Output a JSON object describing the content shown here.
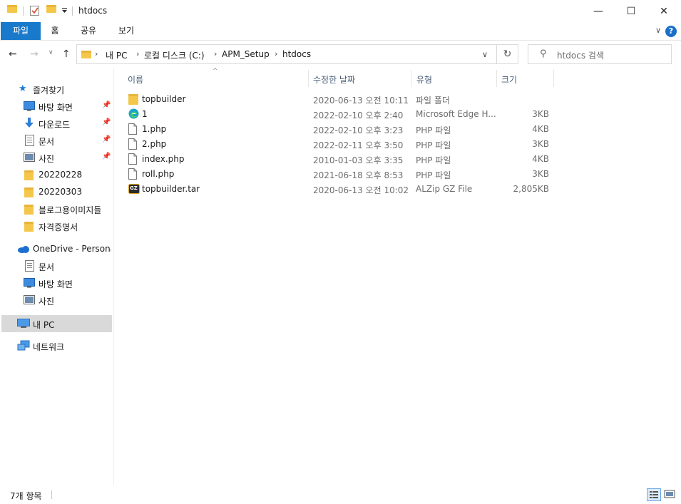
{
  "window": {
    "title": "htdocs",
    "minimize": "—",
    "maximize": "☐",
    "close": "✕"
  },
  "ribbon": {
    "tabs": [
      "파일",
      "홈",
      "공유",
      "보기"
    ],
    "expand": "∨",
    "help": "?"
  },
  "address": {
    "crumbs": [
      "내 PC",
      "로컬 디스크 (C:)",
      "APM_Setup",
      "htdocs"
    ],
    "dropdown": "∨",
    "refresh": "↻"
  },
  "search": {
    "placeholder": "htdocs 검색"
  },
  "sidebar": {
    "quick_access": "즐겨찾기",
    "quick_items": [
      {
        "label": "바탕 화면",
        "icon": "desktop-icon",
        "pinned": true
      },
      {
        "label": "다운로드",
        "icon": "download-icon",
        "pinned": true
      },
      {
        "label": "문서",
        "icon": "document-icon",
        "pinned": true
      },
      {
        "label": "사진",
        "icon": "pictures-icon",
        "pinned": true
      },
      {
        "label": "20220228",
        "icon": "folder-icon",
        "pinned": false
      },
      {
        "label": "20220303",
        "icon": "folder-icon",
        "pinned": false
      },
      {
        "label": "블로그용이미지들",
        "icon": "folder-icon",
        "pinned": false
      },
      {
        "label": "자격증명서",
        "icon": "folder-icon",
        "pinned": false
      }
    ],
    "onedrive": "OneDrive - Personal",
    "onedrive_items": [
      {
        "label": "문서",
        "icon": "document-icon"
      },
      {
        "label": "바탕 화면",
        "icon": "desktop-icon"
      },
      {
        "label": "사진",
        "icon": "pictures-icon"
      }
    ],
    "this_pc": "내 PC",
    "network": "네트워크"
  },
  "columns": {
    "name": "이름",
    "date": "수정한 날짜",
    "type": "유형",
    "size": "크기"
  },
  "files": [
    {
      "name": "topbuilder",
      "date": "2020-06-13 오전 10:11",
      "type": "파일 폴더",
      "size": "",
      "icon": "folder-icon"
    },
    {
      "name": "1",
      "date": "2022-02-10 오후 2:40",
      "type": "Microsoft Edge H...",
      "size": "3KB",
      "icon": "edge-icon"
    },
    {
      "name": "1.php",
      "date": "2022-02-10 오후 3:23",
      "type": "PHP 파일",
      "size": "4KB",
      "icon": "file-icon"
    },
    {
      "name": "2.php",
      "date": "2022-02-11 오후 3:50",
      "type": "PHP 파일",
      "size": "3KB",
      "icon": "file-icon"
    },
    {
      "name": "index.php",
      "date": "2010-01-03 오후 3:35",
      "type": "PHP 파일",
      "size": "4KB",
      "icon": "file-icon"
    },
    {
      "name": "roll.php",
      "date": "2021-06-18 오후 8:53",
      "type": "PHP 파일",
      "size": "3KB",
      "icon": "file-icon"
    },
    {
      "name": "topbuilder.tar",
      "date": "2020-06-13 오전 10:02",
      "type": "ALZip GZ File",
      "size": "2,805KB",
      "icon": "gz-archive-icon"
    }
  ],
  "gz_badge": "GZ",
  "status": {
    "count": "7개 항목"
  },
  "colors": {
    "accent": "#1979ca",
    "folder": "#f4c74b",
    "selected": "#d9d9d9"
  }
}
